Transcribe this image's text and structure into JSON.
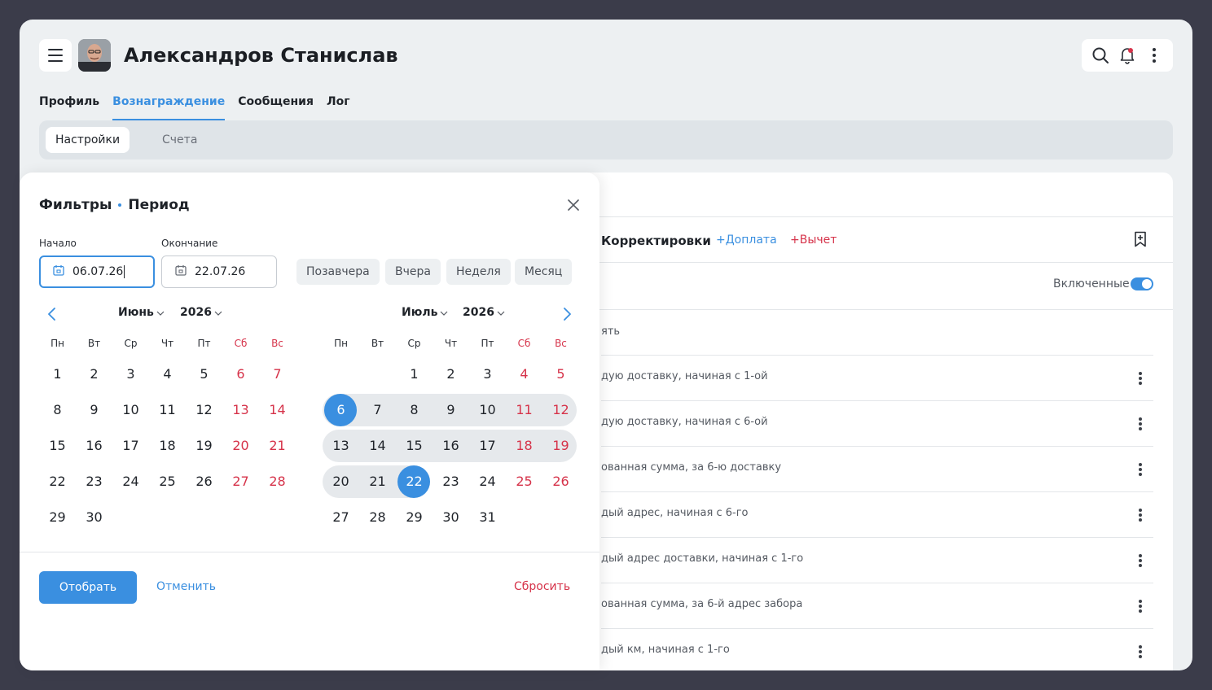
{
  "header": {
    "user_name": "Александров Станислав"
  },
  "main_tabs": [
    {
      "label": "Профиль"
    },
    {
      "label": "Вознаграждение"
    },
    {
      "label": "Сообщения"
    },
    {
      "label": "Лог"
    }
  ],
  "sub_tabs": [
    {
      "label": "Настройки"
    },
    {
      "label": "Счета"
    }
  ],
  "content": {
    "corrections_title": "Корректировки",
    "add_payment": "+Доплата",
    "add_deduction": "+Вычет",
    "toggle_label": "Включенные",
    "toggle_on": true,
    "column_header": "ять",
    "rows": [
      "дую доставку, начиная с 1-ой",
      "дую доставку, начиная с 6-ой",
      "ованная сумма, за 6-ю доставку",
      "дый адрес, начиная с 6-го",
      "дый адрес доставки, начиная с 1-го",
      "ованная сумма, за 6-й адрес забора",
      "дый км, начиная с 1-го"
    ]
  },
  "filter": {
    "title": "Фильтры",
    "subtitle": "Период",
    "start_label": "Начало",
    "start_value": "06.07.26",
    "end_label": "Окончание",
    "end_value": "22.07.26",
    "quick": [
      "Позавчера",
      "Вчера",
      "Неделя",
      "Месяц"
    ],
    "apply": "Отобрать",
    "cancel": "Отменить",
    "reset": "Сбросить",
    "weekdays": [
      "Пн",
      "Вт",
      "Ср",
      "Чт",
      "Пт",
      "Сб",
      "Вс"
    ],
    "calendars": [
      {
        "month": "Июнь",
        "year": "2026",
        "weeks": [
          [
            "1",
            "2",
            "3",
            "4",
            "5",
            "6",
            "7"
          ],
          [
            "8",
            "9",
            "10",
            "11",
            "12",
            "13",
            "14"
          ],
          [
            "15",
            "16",
            "17",
            "18",
            "19",
            "20",
            "21"
          ],
          [
            "22",
            "23",
            "24",
            "25",
            "26",
            "27",
            "28"
          ],
          [
            "29",
            "30",
            "",
            "",
            "",
            "",
            ""
          ]
        ]
      },
      {
        "month": "Июль",
        "year": "2026",
        "weeks": [
          [
            "",
            "",
            "1",
            "2",
            "3",
            "4",
            "5"
          ],
          [
            "6",
            "7",
            "8",
            "9",
            "10",
            "11",
            "12"
          ],
          [
            "13",
            "14",
            "15",
            "16",
            "17",
            "18",
            "19"
          ],
          [
            "20",
            "21",
            "22",
            "23",
            "24",
            "25",
            "26"
          ],
          [
            "27",
            "28",
            "29",
            "30",
            "31",
            "",
            ""
          ]
        ]
      }
    ]
  },
  "colors": {
    "accent": "#3a8fe0",
    "danger": "#d6334a",
    "range": "#e6e9ec"
  }
}
